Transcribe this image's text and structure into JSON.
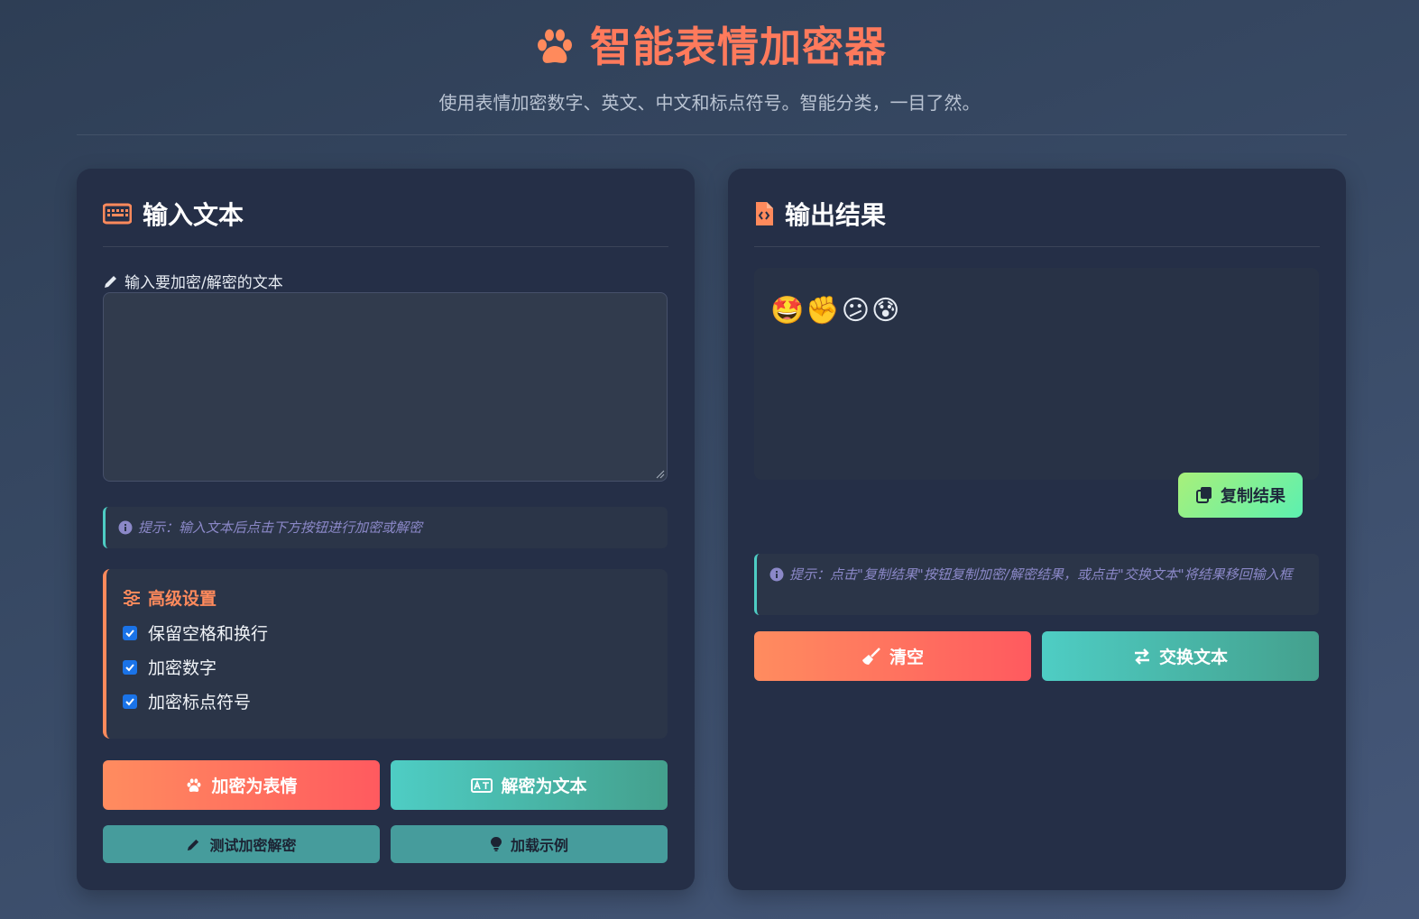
{
  "app": {
    "title": "智能表情加密器",
    "subtitle": "使用表情加密数字、英文、中文和标点符号。智能分类，一目了然。"
  },
  "input_panel": {
    "title": "输入文本",
    "field_label": "输入要加密/解密的文本",
    "textarea_value": "",
    "tip": "提示：输入文本后点击下方按钮进行加密或解密",
    "advanced": {
      "title": "高级设置",
      "options": [
        {
          "label": "保留空格和换行",
          "checked": true
        },
        {
          "label": "加密数字",
          "checked": true
        },
        {
          "label": "加密标点符号",
          "checked": true
        }
      ]
    },
    "buttons": {
      "encrypt": "加密为表情",
      "decrypt": "解密为文本",
      "test": "测试加密解密",
      "example": "加载示例"
    }
  },
  "output_panel": {
    "title": "输出结果",
    "result": "🤩✊😕😰",
    "copy_button": "复制结果",
    "tip": "提示：点击\"复制结果\"按钮复制加密/解密结果，或点击\"交换文本\"将结果移回输入框",
    "buttons": {
      "clear": "清空",
      "swap": "交换文本"
    }
  },
  "icons": {
    "title": "paw-icon",
    "input_header": "keyboard-icon",
    "field_label": "pencil-icon",
    "tip": "info-icon",
    "advanced": "sliders-icon",
    "encrypt": "paw-icon",
    "decrypt": "translate-icon",
    "test": "pencil-icon",
    "example": "lightbulb-icon",
    "output_header": "file-code-icon",
    "copy": "copy-icon",
    "clear": "broom-icon",
    "swap": "swap-icon"
  },
  "colors": {
    "accent_orange": "#ff7a5c",
    "accent_teal": "#4ecdc4",
    "card_bg": "#252f47",
    "tip_text": "#8b88c8",
    "copy_green": "#a8f07a"
  }
}
